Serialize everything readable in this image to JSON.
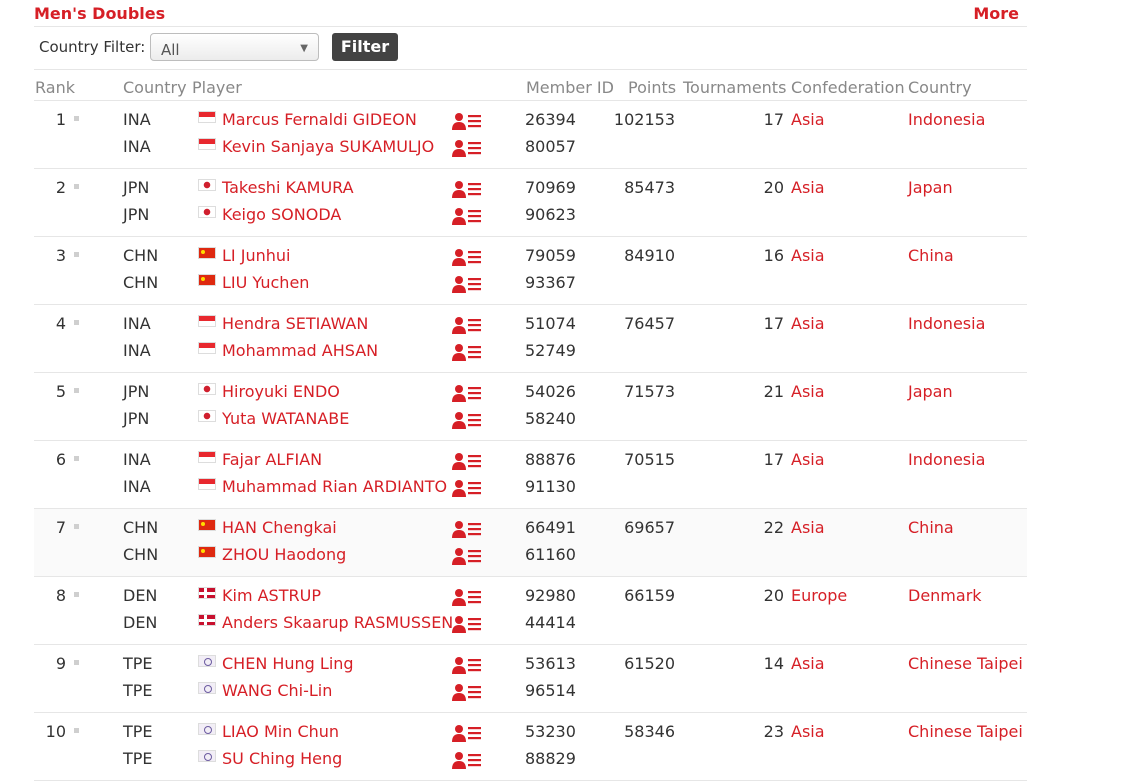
{
  "header": {
    "title": "Men's Doubles",
    "more_label": "More"
  },
  "filter": {
    "label": "Country Filter:",
    "selected": "All",
    "button_label": "Filter"
  },
  "columns": {
    "rank": "Rank",
    "country": "Country",
    "player": "Player",
    "member_id": "Member ID",
    "points": "Points",
    "tournaments": "Tournaments",
    "confederation": "Confederation",
    "country2": "Country"
  },
  "icons": {
    "profile": "player-profile-list-icon",
    "rank_marker": "rank-change-marker-icon"
  },
  "accent_color": "#d61f26",
  "rows": [
    {
      "rank": "1",
      "points": "102153",
      "tournaments": "17",
      "confederation": "Asia",
      "country": "Indonesia",
      "players": [
        {
          "code": "INA",
          "flag": "ina",
          "name": "Marcus Fernaldi GIDEON",
          "member_id": "26394"
        },
        {
          "code": "INA",
          "flag": "ina",
          "name": "Kevin Sanjaya SUKAMULJO",
          "member_id": "80057"
        }
      ]
    },
    {
      "rank": "2",
      "points": "85473",
      "tournaments": "20",
      "confederation": "Asia",
      "country": "Japan",
      "players": [
        {
          "code": "JPN",
          "flag": "jpn",
          "name": "Takeshi KAMURA",
          "member_id": "70969"
        },
        {
          "code": "JPN",
          "flag": "jpn",
          "name": "Keigo SONODA",
          "member_id": "90623"
        }
      ]
    },
    {
      "rank": "3",
      "points": "84910",
      "tournaments": "16",
      "confederation": "Asia",
      "country": "China",
      "players": [
        {
          "code": "CHN",
          "flag": "chn",
          "name": "LI Junhui",
          "member_id": "79059"
        },
        {
          "code": "CHN",
          "flag": "chn",
          "name": "LIU Yuchen",
          "member_id": "93367"
        }
      ]
    },
    {
      "rank": "4",
      "points": "76457",
      "tournaments": "17",
      "confederation": "Asia",
      "country": "Indonesia",
      "players": [
        {
          "code": "INA",
          "flag": "ina",
          "name": "Hendra SETIAWAN",
          "member_id": "51074"
        },
        {
          "code": "INA",
          "flag": "ina",
          "name": "Mohammad AHSAN",
          "member_id": "52749"
        }
      ]
    },
    {
      "rank": "5",
      "points": "71573",
      "tournaments": "21",
      "confederation": "Asia",
      "country": "Japan",
      "players": [
        {
          "code": "JPN",
          "flag": "jpn",
          "name": "Hiroyuki ENDO",
          "member_id": "54026"
        },
        {
          "code": "JPN",
          "flag": "jpn",
          "name": "Yuta WATANABE",
          "member_id": "58240"
        }
      ]
    },
    {
      "rank": "6",
      "points": "70515",
      "tournaments": "17",
      "confederation": "Asia",
      "country": "Indonesia",
      "players": [
        {
          "code": "INA",
          "flag": "ina",
          "name": "Fajar ALFIAN",
          "member_id": "88876"
        },
        {
          "code": "INA",
          "flag": "ina",
          "name": "Muhammad Rian ARDIANTO",
          "member_id": "91130"
        }
      ]
    },
    {
      "rank": "7",
      "points": "69657",
      "tournaments": "22",
      "confederation": "Asia",
      "country": "China",
      "players": [
        {
          "code": "CHN",
          "flag": "chn",
          "name": "HAN Chengkai",
          "member_id": "66491"
        },
        {
          "code": "CHN",
          "flag": "chn",
          "name": "ZHOU Haodong",
          "member_id": "61160"
        }
      ]
    },
    {
      "rank": "8",
      "points": "66159",
      "tournaments": "20",
      "confederation": "Europe",
      "country": "Denmark",
      "players": [
        {
          "code": "DEN",
          "flag": "den",
          "name": "Kim ASTRUP",
          "member_id": "92980"
        },
        {
          "code": "DEN",
          "flag": "den",
          "name": "Anders Skaarup RASMUSSEN",
          "member_id": "44414"
        }
      ]
    },
    {
      "rank": "9",
      "points": "61520",
      "tournaments": "14",
      "confederation": "Asia",
      "country": "Chinese Taipei",
      "players": [
        {
          "code": "TPE",
          "flag": "tpe",
          "name": "CHEN Hung Ling",
          "member_id": "53613"
        },
        {
          "code": "TPE",
          "flag": "tpe",
          "name": "WANG Chi-Lin",
          "member_id": "96514"
        }
      ]
    },
    {
      "rank": "10",
      "points": "58346",
      "tournaments": "23",
      "confederation": "Asia",
      "country": "Chinese Taipei",
      "players": [
        {
          "code": "TPE",
          "flag": "tpe",
          "name": "LIAO Min Chun",
          "member_id": "53230"
        },
        {
          "code": "TPE",
          "flag": "tpe",
          "name": "SU Ching Heng",
          "member_id": "88829"
        }
      ]
    }
  ]
}
